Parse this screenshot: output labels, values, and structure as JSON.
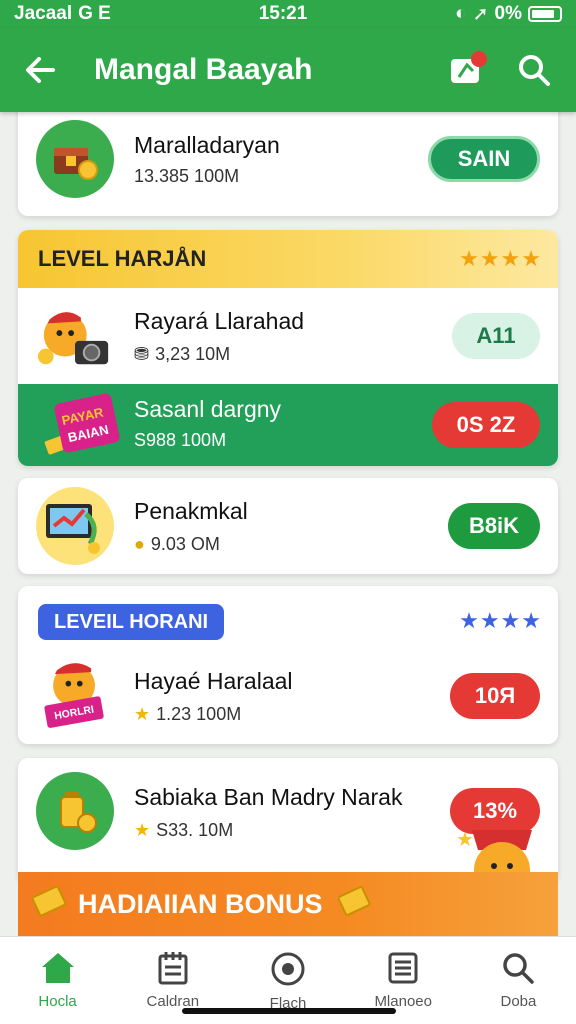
{
  "status_bar": {
    "carrier": "Jacaal",
    "left_icons": "G E",
    "time": "15:21",
    "right_text": "0%"
  },
  "app_bar": {
    "title": "Mangal Baayah"
  },
  "top_item": {
    "title": "Maralladaryan",
    "subtitle": "13.385 100M",
    "button": "SAIN",
    "button_color": "#1e9a5b"
  },
  "level_section": {
    "header": "LEVEL HARJÅN",
    "stars": "★★★★",
    "items": [
      {
        "title": "Rayará Llarahad",
        "subtitle": "3,23 10M",
        "button": "A11"
      },
      {
        "title": "Sasanl dargny",
        "subtitle": "S988 100M",
        "button": "0S 2Z",
        "badge_line1": "PAYAR",
        "badge_line2": "BAIAN"
      }
    ]
  },
  "single_item": {
    "title": "Penakmkal",
    "subtitle": "9.03 ΟM",
    "button": "B8iK"
  },
  "level_section_2": {
    "header": "LEVEIL HORANI",
    "stars": "★★★★",
    "item": {
      "title": "Hayaé Haralaal",
      "subtitle": "1.23 100M",
      "button": "10Я",
      "badge": "HORLRI"
    }
  },
  "last_item": {
    "title": "Sabiaka Ban Madry Narak",
    "subtitle": "S33. 10M",
    "button": "13%"
  },
  "bonus_bar": {
    "label": "HADIAIIAN BONUS"
  },
  "bottom_nav": [
    {
      "label": "Hocla",
      "icon": "home-icon",
      "active": true
    },
    {
      "label": "Caldran",
      "icon": "calendar-icon",
      "active": false
    },
    {
      "label": "Flach",
      "icon": "target-icon",
      "active": false
    },
    {
      "label": "Mlanoeo",
      "icon": "list-icon",
      "active": false
    },
    {
      "label": "Doba",
      "icon": "search-icon",
      "active": false
    }
  ],
  "colors": {
    "primary": "#2fa84a",
    "accent_red": "#e53935",
    "gold": "#f7c531",
    "orange": "#f47b20"
  }
}
